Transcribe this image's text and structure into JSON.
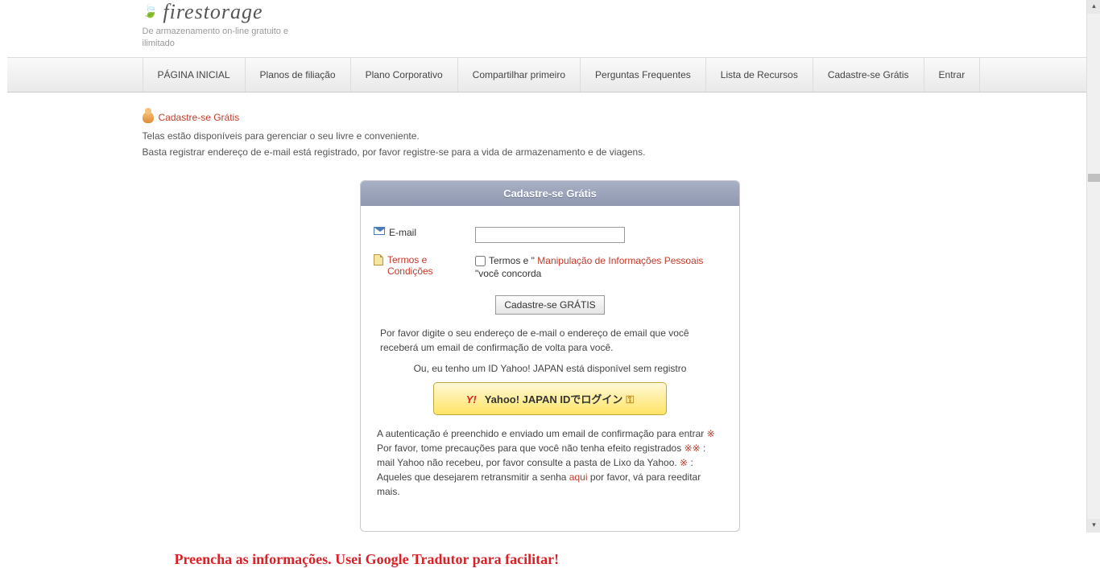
{
  "header": {
    "site_name": "firestorage",
    "tagline": "De armazenamento on-line gratuito e ilimitado"
  },
  "nav": {
    "items": [
      "PÁGINA INICIAL",
      "Planos de filiação",
      "Plano Corporativo",
      "Compartilhar primeiro",
      "Perguntas Frequentes",
      "Lista de Recursos",
      "Cadastre-se Grátis",
      "Entrar"
    ]
  },
  "page": {
    "heading_link": "Cadastre-se Grátis",
    "intro_line1": "Telas estão disponíveis para gerenciar o seu livre e conveniente.",
    "intro_line2": "Basta registrar endereço de e-mail está registrado, por favor registre-se para a vida de armazenamento e de viagens."
  },
  "form": {
    "title": "Cadastre-se Grátis",
    "email_label": "E-mail",
    "terms_label": "Termos e Condições",
    "checkbox_prefix": "Termos e \"",
    "privacy_link": "Manipulação de Informações Pessoais",
    "checkbox_suffix": "\"você concorda",
    "submit_label": "Cadastre-se GRÁTIS",
    "note": "Por favor digite o seu endereço de e-mail o endereço de email que você receberá um email de confirmação de volta para você.",
    "or_text": "Ou, eu tenho um ID Yahoo! JAPAN está disponível sem registro",
    "yahoo_y": "Y!",
    "yahoo_label": "Yahoo! JAPAN IDでログイン",
    "yahoo_key": "⚿",
    "disclaimer_part1": "A autenticação é preenchido e enviado um email de confirmação para entrar ",
    "disclaimer_part2": " Por favor, tome precauções para que você não tenha efeito registrados ",
    "disclaimer_part3": " : mail Yahoo não recebeu, por favor consulte a pasta de Lixo da Yahoo. ",
    "disclaimer_part4": " : Aqueles que desejarem retransmitir a senha ",
    "aqui_link": "aqui",
    "disclaimer_part5": " por favor, vá para reeditar mais.",
    "star": "※"
  },
  "annotation": "Preencha as informações. Usei Google Tradutor para facilitar!"
}
